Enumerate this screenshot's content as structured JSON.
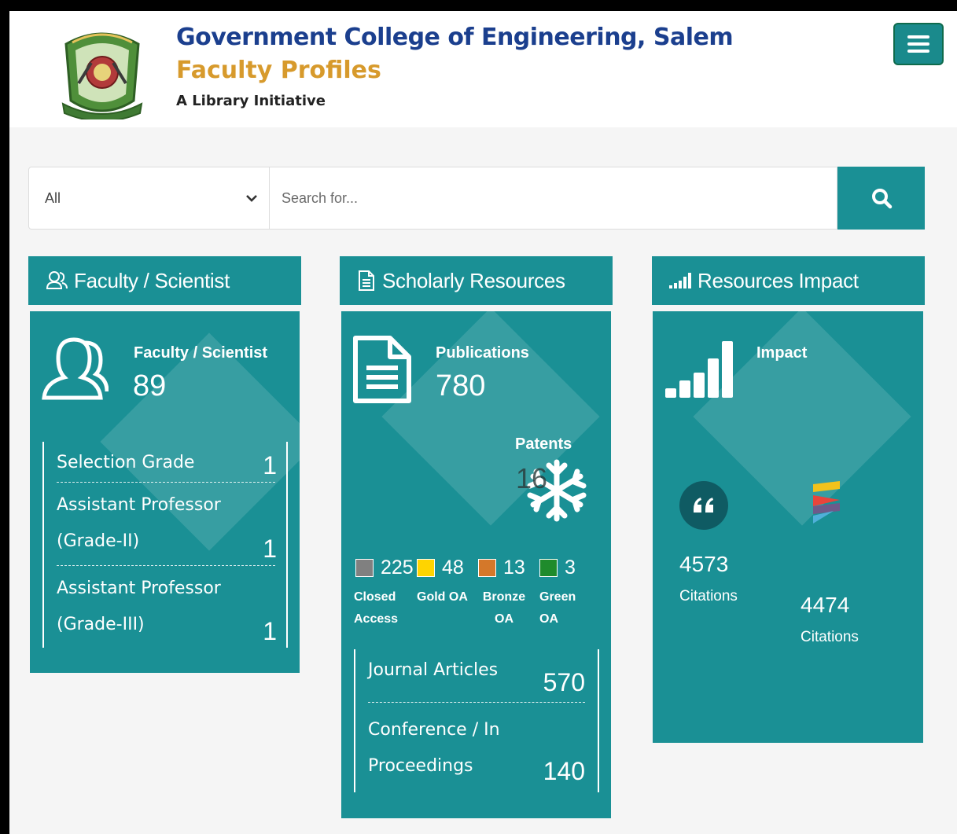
{
  "header": {
    "title": "Government College of Engineering, Salem",
    "subtitle": "Faculty Profiles",
    "tagline": "A Library Initiative"
  },
  "search": {
    "category_selected": "All",
    "placeholder": "Search for..."
  },
  "faculty": {
    "heading": "Faculty / Scientist",
    "stat_label": "Faculty / Scientist",
    "stat_value": "89",
    "items": [
      {
        "label": "Selection Grade",
        "count": "1"
      },
      {
        "label": "Assistant Professor (Grade-II)",
        "count": "1"
      },
      {
        "label": "Assistant Professor (Grade-III)",
        "count": "1"
      }
    ]
  },
  "scholarly": {
    "heading": "Scholarly Resources",
    "publications_label": "Publications",
    "publications_value": "780",
    "patents_label": "Patents",
    "patents_value": "16",
    "access": [
      {
        "count": "225",
        "label": "Closed Access",
        "color": "#808080"
      },
      {
        "count": "48",
        "label": "Gold OA",
        "color": "#ffd400"
      },
      {
        "count": "13",
        "label": "Bronze OA",
        "color": "#d4782a"
      },
      {
        "count": "3",
        "label": "Green OA",
        "color": "#1f8b2c"
      }
    ],
    "items": [
      {
        "label": "Journal Articles",
        "count": "570"
      },
      {
        "label": "Conference / In Proceedings",
        "count": "140"
      }
    ]
  },
  "impact": {
    "heading": "Resources Impact",
    "label": "Impact",
    "sources": [
      {
        "icon": "quote-icon",
        "value": "4573",
        "label": "Citations"
      },
      {
        "icon": "dimensions-icon",
        "value": "4474",
        "label": "Citations"
      }
    ]
  },
  "colors": {
    "teal": "#1a9095",
    "title_blue": "#1b3f8e",
    "title_gold": "#d79a2c"
  }
}
